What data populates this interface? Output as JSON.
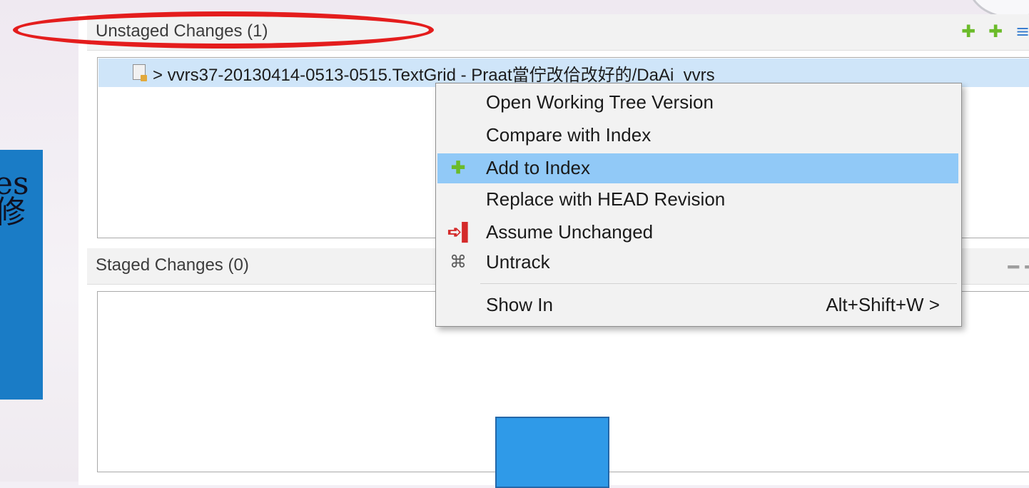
{
  "callout": {
    "text": "es\n修"
  },
  "unstaged": {
    "title": "Unstaged Changes (1)",
    "file": "> vvrs37-20130414-0513-0515.TextGrid - Praat當佇改佮改好的/DaAi_vvrs"
  },
  "staged": {
    "title": "Staged Changes (0)"
  },
  "context_menu": {
    "items": [
      {
        "label": "Open Working Tree Version"
      },
      {
        "label": "Compare with Index"
      },
      {
        "label": "Add to Index",
        "icon": "add-plus-icon"
      },
      {
        "label": "Replace with HEAD Revision"
      },
      {
        "label": "Assume Unchanged",
        "icon": "assume-unchanged-icon"
      },
      {
        "label": "Untrack",
        "icon": "untrack-icon"
      },
      {
        "label": "Show In",
        "shortcut": "Alt+Shift+W >"
      }
    ]
  },
  "colors": {
    "highlight": "#91c9f7",
    "annotation": "#e41d1d",
    "callout": "#1a7cc6"
  }
}
